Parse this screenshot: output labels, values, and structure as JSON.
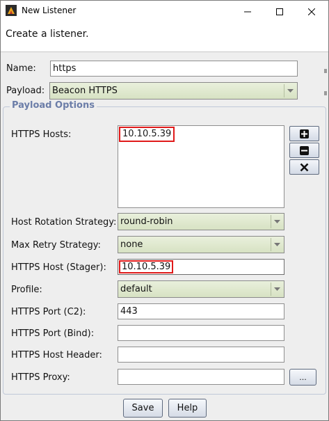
{
  "window": {
    "title": "New Listener"
  },
  "banner": {
    "text": "Create a listener."
  },
  "form": {
    "name_label": "Name:",
    "name_value": "https",
    "payload_label": "Payload:",
    "payload_value": "Beacon HTTPS"
  },
  "payload_options": {
    "title": "Payload Options",
    "hosts_label": "HTTPS Hosts:",
    "hosts": [
      "10.10.5.39"
    ],
    "rotation_label": "Host Rotation Strategy:",
    "rotation_value": "round-robin",
    "retry_label": "Max Retry Strategy:",
    "retry_value": "none",
    "stager_label": "HTTPS Host (Stager):",
    "stager_value": "10.10.5.39",
    "profile_label": "Profile:",
    "profile_value": "default",
    "port_c2_label": "HTTPS Port (C2):",
    "port_c2_value": "443",
    "port_bind_label": "HTTPS Port (Bind):",
    "port_bind_value": "",
    "host_header_label": "HTTPS Host Header:",
    "host_header_value": "",
    "proxy_label": "HTTPS Proxy:",
    "proxy_value": "",
    "proxy_button": "..."
  },
  "buttons": {
    "save": "Save",
    "help": "Help"
  },
  "colors": {
    "highlight": "#e01a1a",
    "combo": "#dde6cc",
    "group_title": "#6b7da8"
  }
}
